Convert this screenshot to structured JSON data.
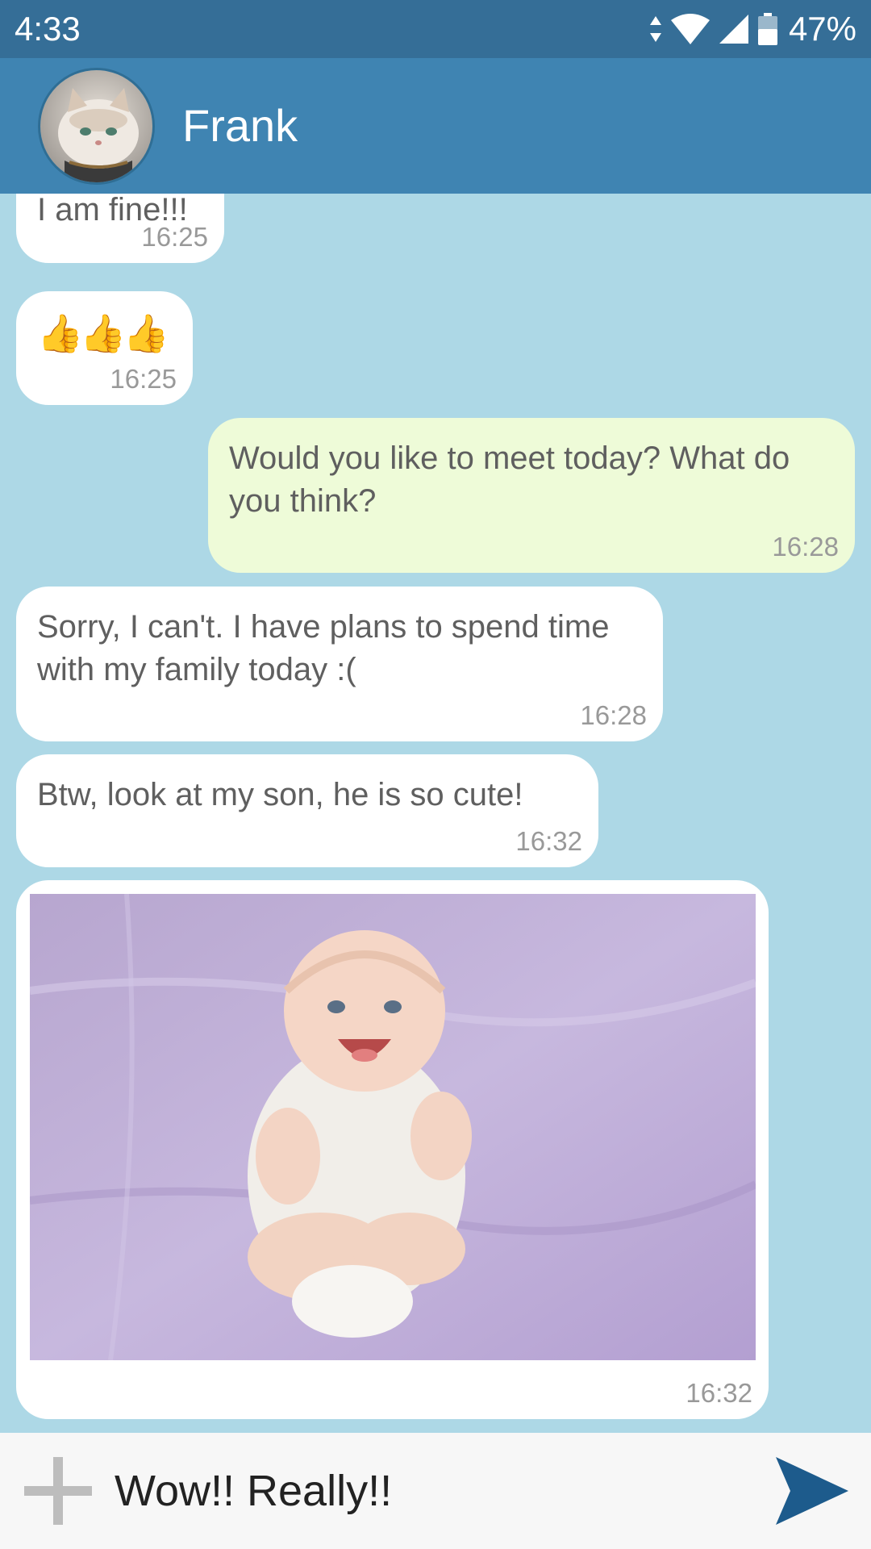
{
  "status_bar": {
    "time": "4:33",
    "battery": "47%"
  },
  "header": {
    "contact_name": "Frank"
  },
  "messages": [
    {
      "direction": "incoming",
      "text": "I am fine!!!",
      "time": "16:25"
    },
    {
      "direction": "incoming",
      "text": "👍👍👍",
      "time": "16:25"
    },
    {
      "direction": "outgoing",
      "text": "Would you like to meet today? What do you think?",
      "time": "16:28"
    },
    {
      "direction": "incoming",
      "text": "Sorry, I can't. I have plans to spend time with my family today :(",
      "time": "16:28"
    },
    {
      "direction": "incoming",
      "text": "Btw, look at my son, he is so cute!",
      "time": "16:32"
    },
    {
      "direction": "incoming",
      "type": "image",
      "time": "16:32"
    }
  ],
  "compose": {
    "value": "Wow!! Really!!"
  },
  "colors": {
    "status_bar": "#356e97",
    "header": "#3f84b2",
    "chat_background": "#add8e6",
    "incoming_bubble": "#ffffff",
    "outgoing_bubble": "#eefbd8",
    "send_icon": "#1d5b8c"
  },
  "icons": [
    "data-arrows-icon",
    "wifi-icon",
    "cell-signal-icon",
    "battery-icon",
    "add-icon",
    "send-icon"
  ]
}
